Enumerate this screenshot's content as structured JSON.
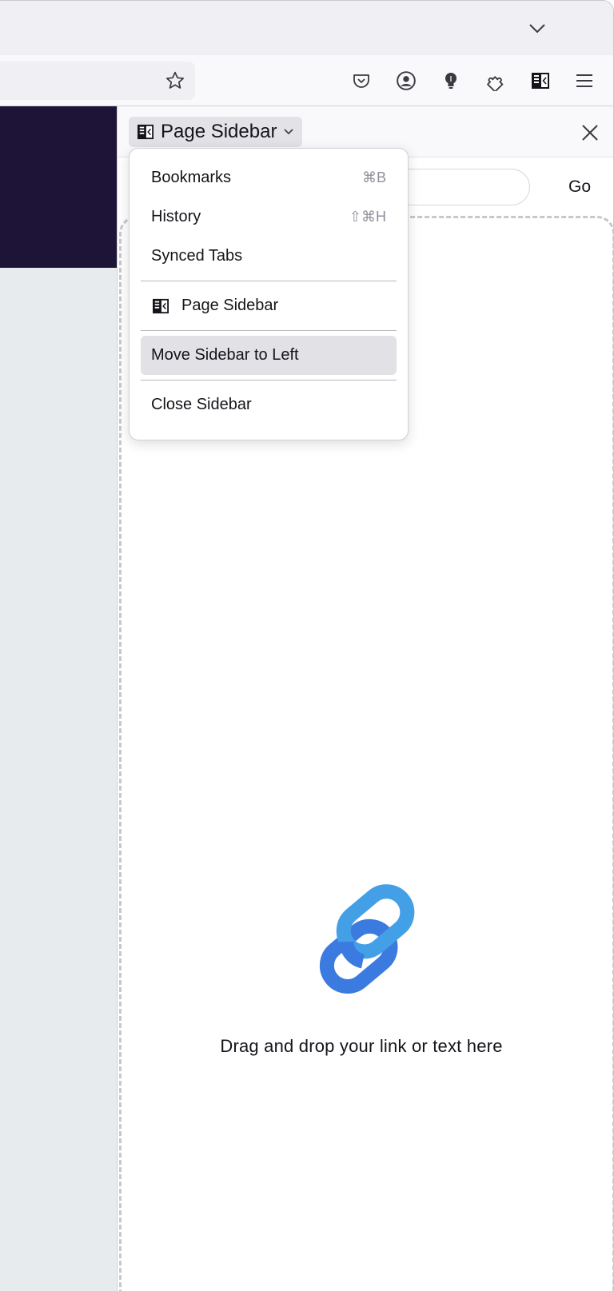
{
  "toolbar": {
    "icons": [
      "chevron-down-icon",
      "star-icon",
      "pocket-icon",
      "account-icon",
      "lightbulb-icon",
      "extensions-icon",
      "sidebar-icon",
      "menu-icon"
    ]
  },
  "sidebar": {
    "switcher_label": "Page Sidebar",
    "go_label": "Go",
    "search_placeholder": "",
    "drop_text": "Drag and drop your link or text here"
  },
  "menu": {
    "bookmarks": {
      "label": "Bookmarks",
      "shortcut": "⌘B"
    },
    "history": {
      "label": "History",
      "shortcut": "⇧⌘H"
    },
    "synced_tabs": {
      "label": "Synced Tabs"
    },
    "page_sidebar": {
      "label": "Page Sidebar"
    },
    "move_sidebar": {
      "label": "Move Sidebar to Left"
    },
    "close_sidebar": {
      "label": "Close Sidebar"
    }
  },
  "colors": {
    "accent_blue": "#3b7be0",
    "accent_light_blue": "#44a0e6",
    "dark_band": "#1d1438"
  }
}
